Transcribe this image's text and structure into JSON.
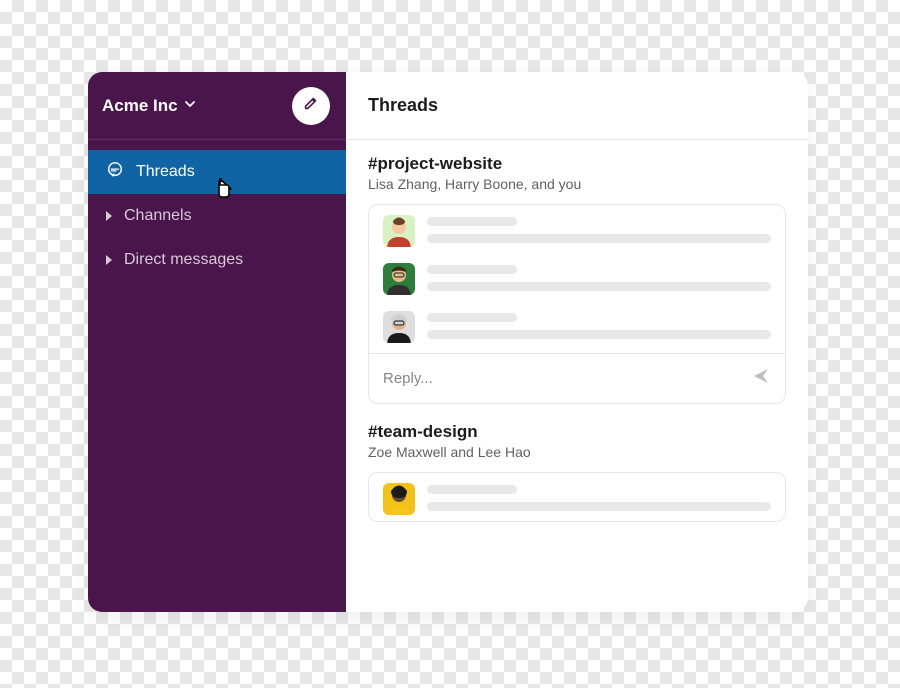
{
  "workspace": {
    "name": "Acme Inc"
  },
  "sidebar": {
    "items": {
      "threads": {
        "label": "Threads"
      },
      "channels": {
        "label": "Channels"
      },
      "direct_messages": {
        "label": "Direct messages"
      }
    }
  },
  "main": {
    "title": "Threads"
  },
  "threads": [
    {
      "channel": "#project-website",
      "participants": "Lisa Zhang, Harry Boone, and you",
      "messages": [
        {
          "avatar_bg": "#d9f2c4",
          "head": "#f2c9a3",
          "body": "#c33f2e",
          "hair": "#6b3f2a"
        },
        {
          "avatar_bg": "#2e7d3a",
          "head": "#e6b98c",
          "body": "#2f2f2f",
          "hair": "#3a2a1a"
        },
        {
          "avatar_bg": "#dedede",
          "head": "#e0b090",
          "body": "#1a1a1a",
          "hair": "#cfcfcf"
        }
      ],
      "reply_placeholder": "Reply..."
    },
    {
      "channel": "#team-design",
      "participants": "Zoe Maxwell and Lee Hao",
      "messages": [
        {
          "avatar_bg": "#f0c21a",
          "head": "#6b4a33",
          "body": "#f5c518",
          "hair": "#1a1a1a"
        }
      ]
    }
  ]
}
